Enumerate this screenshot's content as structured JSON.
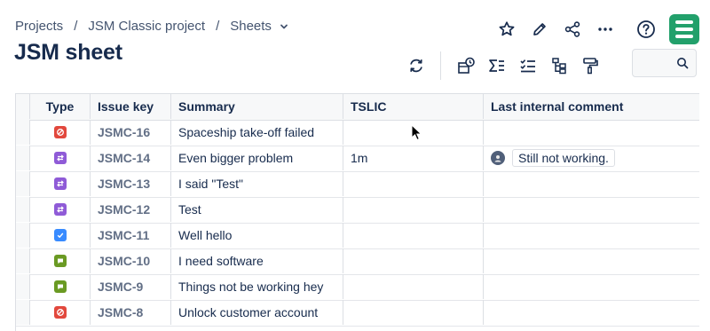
{
  "breadcrumb": {
    "projects": "Projects",
    "project": "JSM Classic project",
    "section": "Sheets",
    "separator": "/"
  },
  "page_title": "JSM sheet",
  "search": {
    "placeholder": "",
    "value": ""
  },
  "colors": {
    "brand": "#22a06b",
    "incident": "#e2483d",
    "change": "#8f5bd7",
    "task": "#388bff",
    "service": "#6a9a23"
  },
  "table": {
    "columns": [
      "Type",
      "Issue key",
      "Summary",
      "TSLIC",
      "Last internal comment"
    ],
    "rows": [
      {
        "type": "incident",
        "key": "JSMC-16",
        "summary": "Spaceship take-off failed",
        "tslic": "",
        "comment": ""
      },
      {
        "type": "change",
        "key": "JSMC-14",
        "summary": "Even bigger problem",
        "tslic": "1m",
        "comment": "Still not working."
      },
      {
        "type": "change",
        "key": "JSMC-13",
        "summary": "I said \"Test\"",
        "tslic": "",
        "comment": ""
      },
      {
        "type": "change",
        "key": "JSMC-12",
        "summary": "Test",
        "tslic": "",
        "comment": ""
      },
      {
        "type": "task",
        "key": "JSMC-11",
        "summary": "Well hello",
        "tslic": "",
        "comment": ""
      },
      {
        "type": "service",
        "key": "JSMC-10",
        "summary": "I need software",
        "tslic": "",
        "comment": ""
      },
      {
        "type": "service",
        "key": "JSMC-9",
        "summary": "Things not be working hey",
        "tslic": "",
        "comment": ""
      },
      {
        "type": "incident",
        "key": "JSMC-8",
        "summary": "Unlock customer account",
        "tslic": "",
        "comment": ""
      }
    ]
  }
}
